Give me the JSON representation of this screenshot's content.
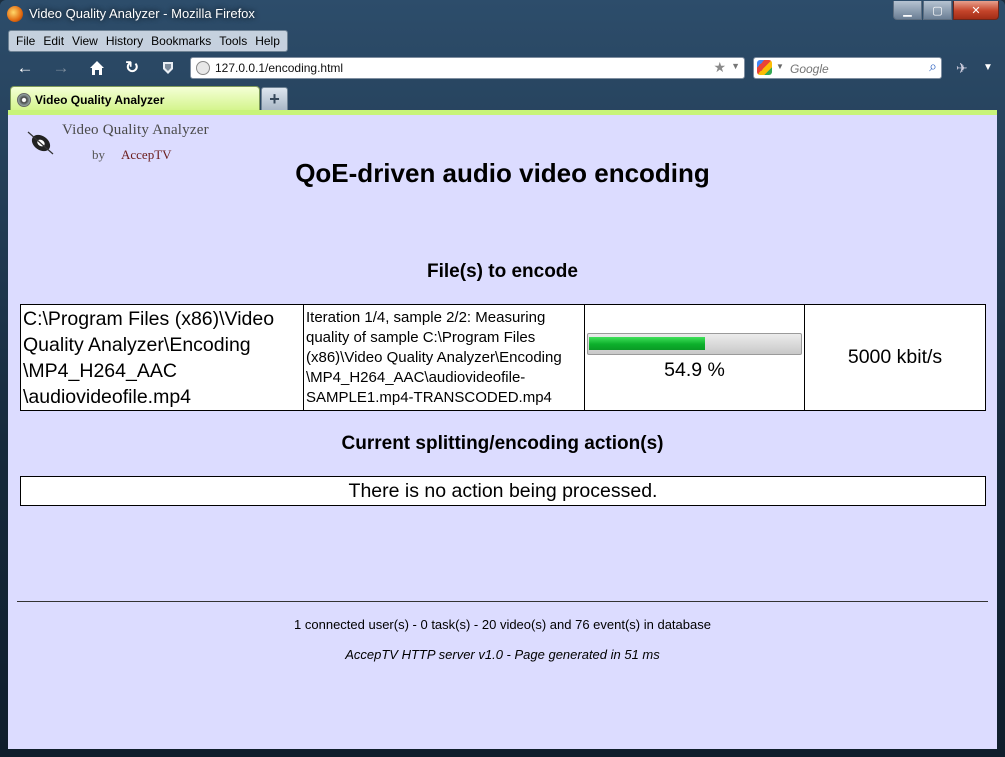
{
  "window": {
    "title": "Video Quality Analyzer - Mozilla Firefox",
    "controls": {
      "minimize": "▁",
      "maximize": "▢",
      "close": "✕"
    }
  },
  "menubar": {
    "items": [
      "File",
      "Edit",
      "View",
      "History",
      "Bookmarks",
      "Tools",
      "Help"
    ]
  },
  "navbar": {
    "back_icon": "back-arrow-icon",
    "forward_icon": "forward-arrow-icon",
    "home_icon": "home-icon",
    "reload_icon": "reload-icon",
    "stop_icon": "shield-icon",
    "url": "127.0.0.1/encoding.html",
    "search_placeholder": "Google"
  },
  "tabs": [
    {
      "label": "Video Quality Analyzer",
      "active": true
    }
  ],
  "page": {
    "logo": {
      "line1": "Video Quality Analyzer",
      "by": "by",
      "brand": "AccepTV"
    },
    "title": "QoE-driven audio video encoding",
    "files_heading": "File(s) to encode",
    "files": [
      {
        "path": "C:\\Program Files (x86)\\Video Quality Analyzer\\Encoding \\MP4_H264_AAC \\audiovideofile.mp4",
        "status": "Iteration 1/4, sample 2/2: Measuring quality of sample C:\\Program Files (x86)\\Video Quality Analyzer\\Encoding \\MP4_H264_AAC\\audiovideofile-SAMPLE1.mp4-TRANSCODED.mp4",
        "progress_percent": 54.9,
        "progress_label": "54.9 %",
        "bitrate": "5000 kbit/s"
      }
    ],
    "actions_heading": "Current splitting/encoding action(s)",
    "action_message": "There is no action being processed.",
    "footer_stats": "1 connected user(s) - 0 task(s) - 20 video(s) and 76 event(s) in database",
    "footer_server": "AccepTV HTTP server v1.0 - Page generated in 51 ms"
  },
  "colors": {
    "page_background": "#dcdcff",
    "tab_active": "#d3f48a",
    "progress_fill": "#0db02c"
  }
}
